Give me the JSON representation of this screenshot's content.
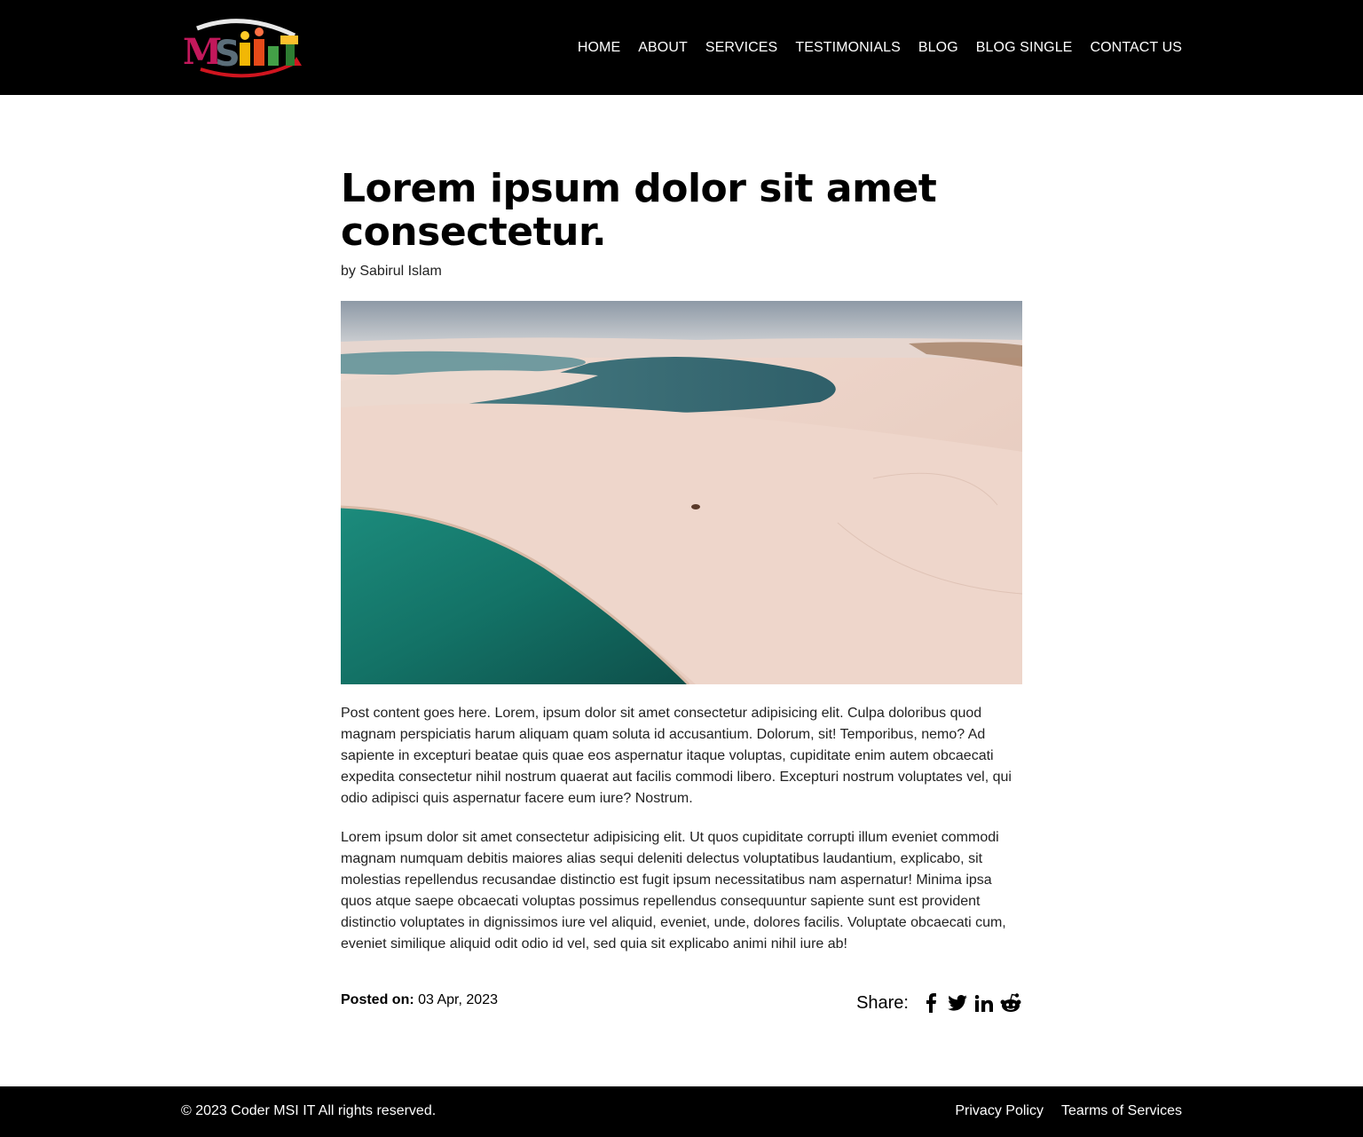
{
  "header": {
    "logo_text": "MSIIT",
    "nav": [
      {
        "label": "HOME"
      },
      {
        "label": "ABOUT"
      },
      {
        "label": "SERVICES"
      },
      {
        "label": "TESTIMONIALS"
      },
      {
        "label": "BLOG"
      },
      {
        "label": "BLOG SINGLE"
      },
      {
        "label": "CONTACT US"
      }
    ]
  },
  "post": {
    "title": "Lorem ipsum dolor sit amet consectetur.",
    "byline": "by Sabirul Islam",
    "image_alt": "",
    "paragraphs": [
      "Post content goes here. Lorem, ipsum dolor sit amet consectetur adipisicing elit. Culpa doloribus quod magnam perspiciatis harum aliquam quam soluta id accusantium. Dolorum, sit! Temporibus, nemo? Ad sapiente in excepturi beatae quis quae eos aspernatur itaque voluptas, cupiditate enim autem obcaecati expedita consectetur nihil nostrum quaerat aut facilis commodi libero. Excepturi nostrum voluptates vel, qui odio adipisci quis aspernatur facere eum iure? Nostrum.",
      "Lorem ipsum dolor sit amet consectetur adipisicing elit. Ut quos cupiditate corrupti illum eveniet commodi magnam numquam debitis maiores alias sequi deleniti delectus voluptatibus laudantium, explicabo, sit molestias repellendus recusandae distinctio est fugit ipsum necessitatibus nam aspernatur! Minima ipsa quos atque saepe obcaecati voluptas possimus repellendus consequuntur sapiente sunt est provident distinctio voluptates in dignissimos iure vel aliquid, eveniet, unde, dolores facilis. Voluptate obcaecati cum, eveniet similique aliquid odit odio id vel, sed quia sit explicabo animi nihil iure ab!"
    ],
    "posted_label": "Posted on:",
    "posted_date": "03 Apr, 2023",
    "share_label": "Share:",
    "share_icons": [
      "facebook-icon",
      "twitter-icon",
      "linkedin-icon",
      "reddit-icon"
    ]
  },
  "footer": {
    "copyright": "© 2023 Coder MSI IT All rights reserved.",
    "links": [
      {
        "label": "Privacy Policy"
      },
      {
        "label": "Tearms of Services"
      }
    ]
  },
  "colors": {
    "header_bg": "#000000",
    "footer_bg": "#000000",
    "page_bg": "#ffffff",
    "text": "#000000"
  }
}
